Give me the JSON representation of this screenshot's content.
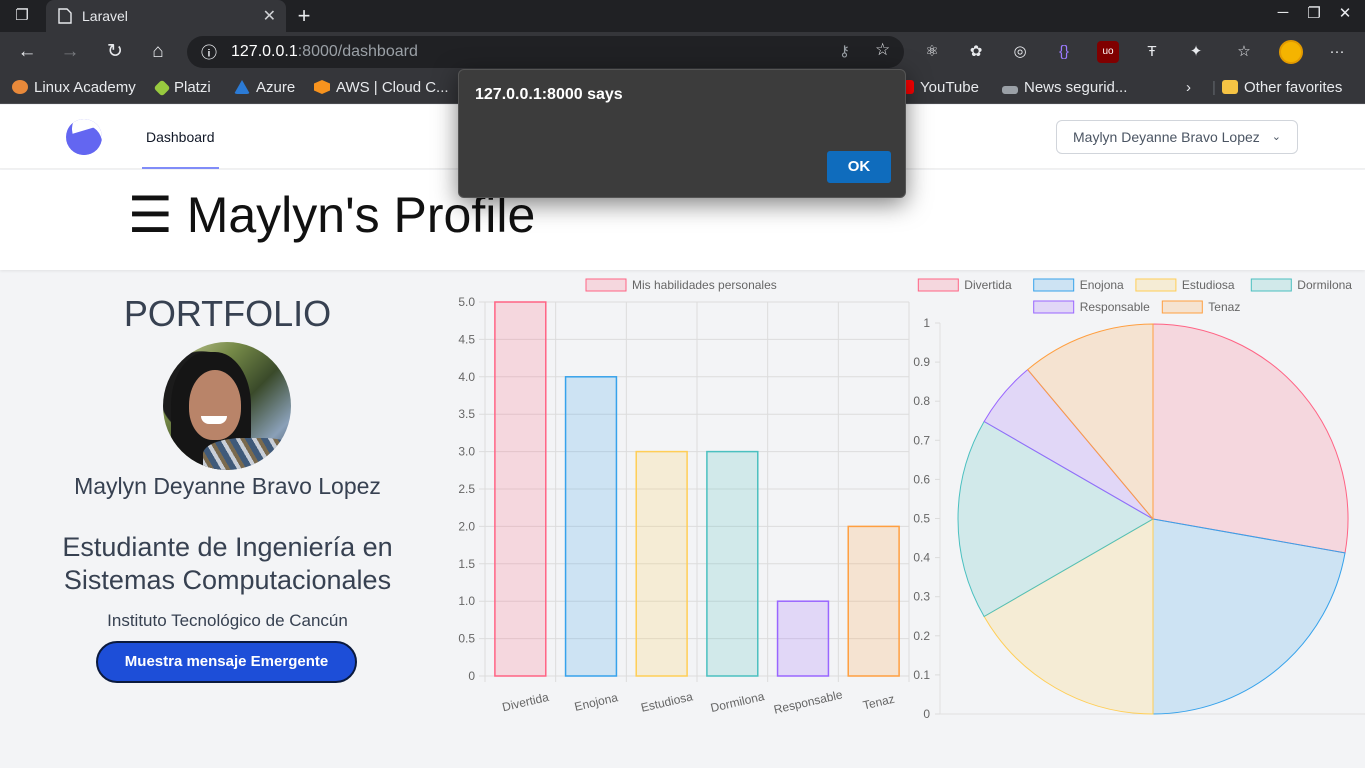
{
  "browser": {
    "tab_title": "Laravel",
    "url_host": "127.0.0.1",
    "url_rest": ":8000/dashboard",
    "bookmarks": [
      "Linux Academy",
      "Platzi",
      "Azure",
      "AWS | Cloud C...",
      "YouTube",
      "News segurid...",
      "Other favorites"
    ],
    "bookmark_colors": [
      "#e8893a",
      "#98ca3f",
      "#2b7bd6",
      "#f7931e",
      "#ff0000",
      "#9aa0a6",
      "#f5c344"
    ]
  },
  "alert": {
    "message": "127.0.0.1:8000 says",
    "ok_label": "OK"
  },
  "nav": {
    "link": "Dashboard",
    "user": "Maylyn Deyanne Bravo Lopez"
  },
  "header": {
    "title": "☰ Maylyn's Profile"
  },
  "profile": {
    "section_title": "PORTFOLIO",
    "name": "Maylyn Deyanne Bravo Lopez",
    "career": "Estudiante de Ingeniería en Sistemas Computacionales",
    "school": "Instituto Tecnológico de Cancún",
    "button": "Muestra mensaje Emergente"
  },
  "chart_data": [
    {
      "type": "bar",
      "legend": "Mis habilidades personales",
      "categories": [
        "Divertida",
        "Enojona",
        "Estudiosa",
        "Dormilona",
        "Responsable",
        "Tenaz"
      ],
      "values": [
        5,
        4,
        3,
        3,
        1,
        2
      ],
      "ylim": [
        0,
        5
      ],
      "yticks": [
        "0",
        "0.5",
        "1.0",
        "1.5",
        "2.0",
        "2.5",
        "3.0",
        "3.5",
        "4.0",
        "4.5",
        "5.0"
      ],
      "colors": [
        "#ff6384",
        "#36a2eb",
        "#ffce56",
        "#4bc0c0",
        "#9966ff",
        "#ff9f40"
      ],
      "grid": true
    },
    {
      "type": "pie",
      "categories": [
        "Divertida",
        "Enojona",
        "Estudiosa",
        "Dormilona",
        "Responsable",
        "Tenaz"
      ],
      "values": [
        5,
        4,
        3,
        3,
        1,
        2
      ],
      "colors": [
        "#ff6384",
        "#36a2eb",
        "#ffce56",
        "#4bc0c0",
        "#9966ff",
        "#ff9f40"
      ],
      "yticks": [
        "0",
        "0.1",
        "0.2",
        "0.3",
        "0.4",
        "0.5",
        "0.6",
        "0.7",
        "0.8",
        "0.9",
        "1"
      ],
      "legend_position": "top"
    }
  ]
}
